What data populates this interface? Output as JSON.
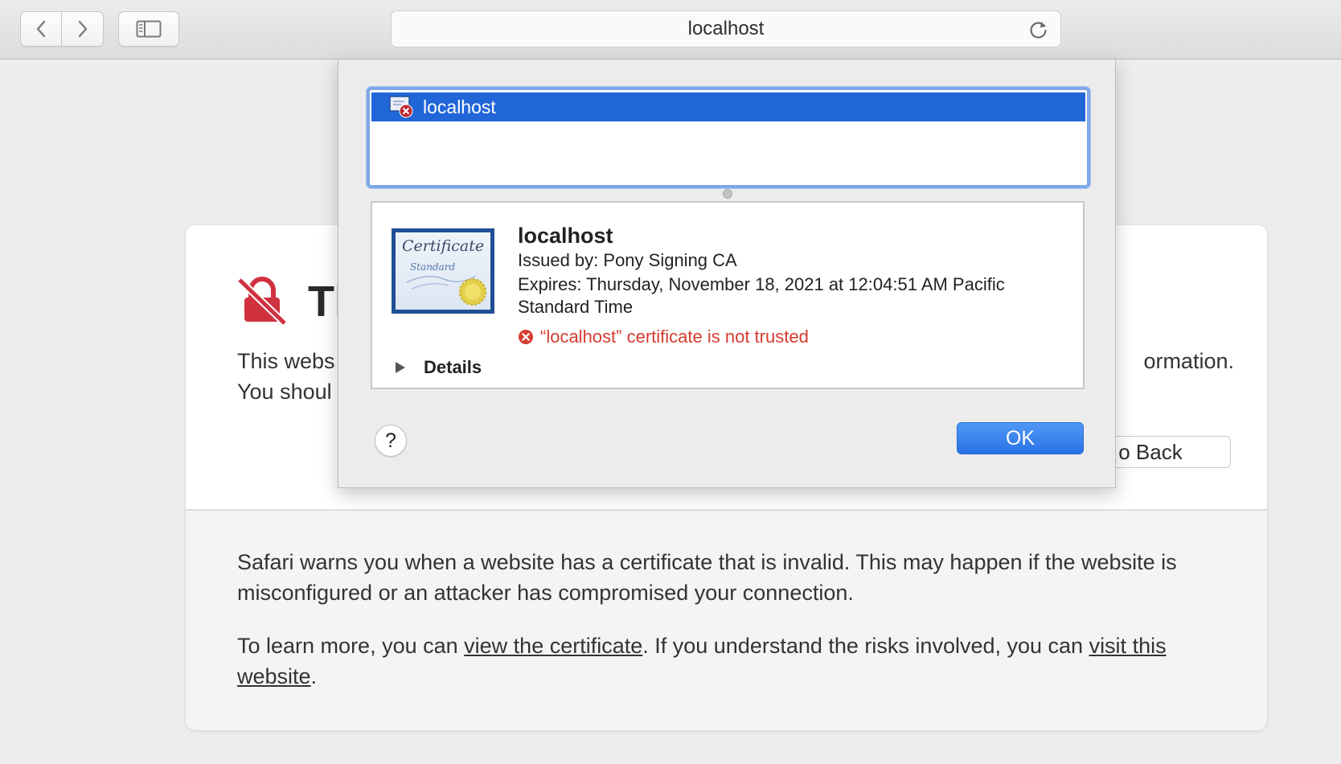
{
  "toolbar": {
    "address": "localhost",
    "icons": {
      "back": "chevron-left-icon",
      "forward": "chevron-right-icon",
      "sidebar": "sidebar-icon",
      "reload": "reload-icon"
    }
  },
  "warning": {
    "title": "Th",
    "line1": "This webs",
    "line1_end": "ormation.",
    "line2": "You shoul",
    "go_back_label": "o Back",
    "info1": "Safari warns you when a website has a certificate that is invalid. This may happen if the website is misconfigured or an attacker has compromised your connection.",
    "info2_pre": "To learn more, you can ",
    "info2_link1": "view the certificate",
    "info2_mid": ". If you understand the risks involved, you can ",
    "info2_link2": "visit this website",
    "info2_post": ".",
    "icon": "broken-lock-icon",
    "accent_color": "#d0313e"
  },
  "sheet": {
    "list_item": "localhost",
    "cert": {
      "name": "localhost",
      "issued_by": "Issued by: Pony Signing CA",
      "expires": "Expires: Thursday, November 18, 2021 at 12:04:51 AM Pacific Standard Time",
      "error": "“localhost” certificate is not trusted",
      "image_script_1": "Certificate",
      "image_script_2": "Standard"
    },
    "details_label": "Details",
    "help_label": "?",
    "ok_label": "OK",
    "selection_color": "#2166d8",
    "error_color": "#d63b2f"
  }
}
